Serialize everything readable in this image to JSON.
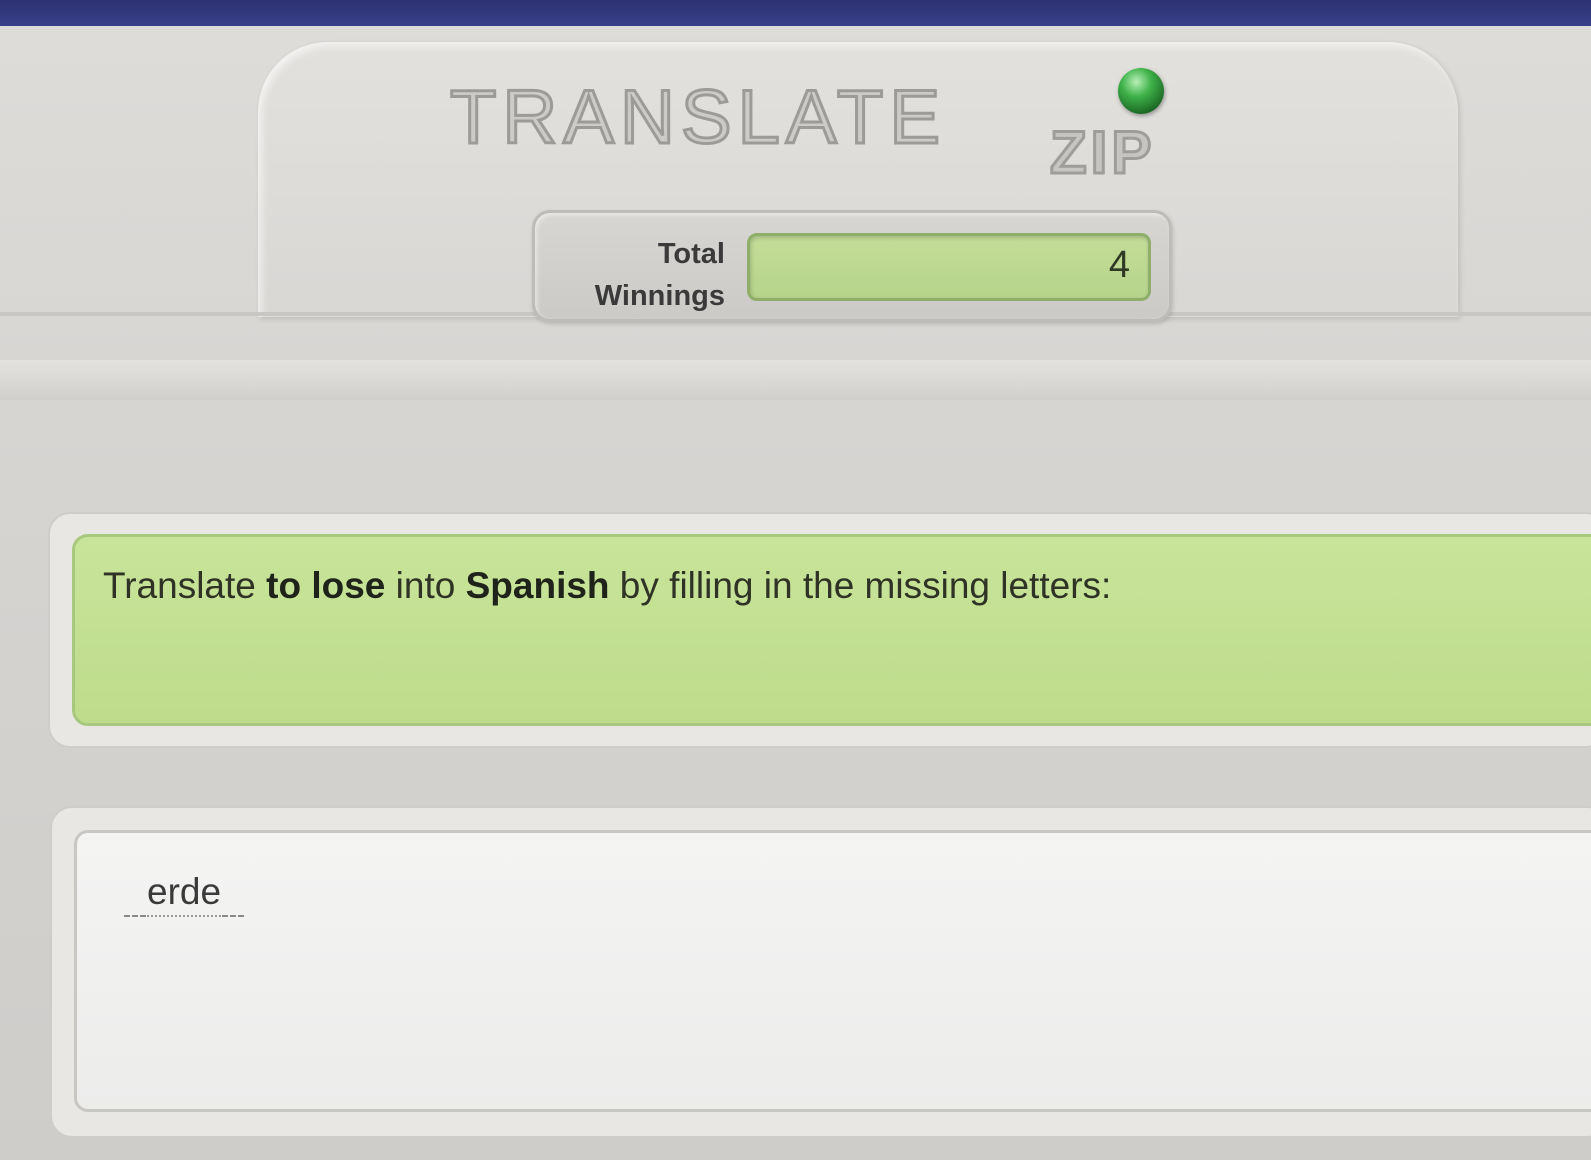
{
  "header": {
    "logo_text": "TRANSLATE",
    "logo_sub": "ZIP",
    "status_light_color": "#3fb24a"
  },
  "winnings": {
    "label": "Total\nWinnings",
    "value": "4"
  },
  "question": {
    "prefix": "Translate ",
    "term": "to lose",
    "middle": " into ",
    "language": "Spanish",
    "suffix": " by filling in the missing letters:"
  },
  "answer": {
    "visible_letters": "erde",
    "blanks_before": 1,
    "blanks_after": 1
  },
  "colors": {
    "top_bar": "#2c3273",
    "question_bg": "#c8e49a",
    "winnings_bg": "#c4dd99"
  }
}
